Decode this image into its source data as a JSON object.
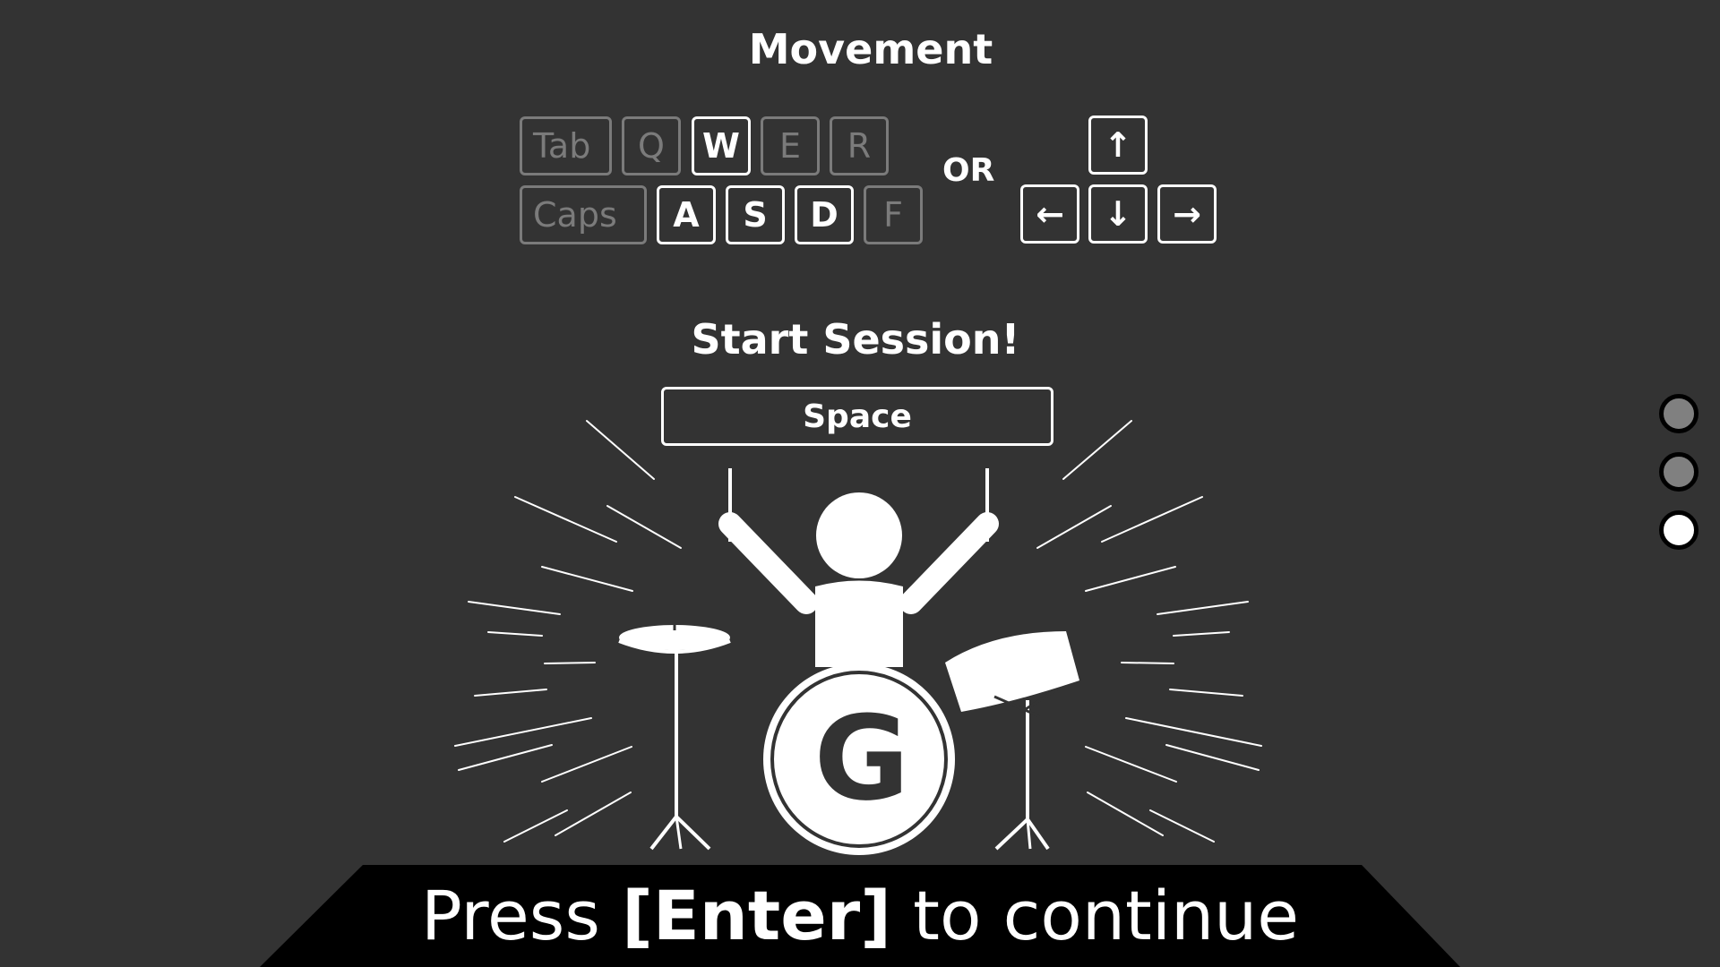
{
  "movement": {
    "title": "Movement",
    "or_label": "OR",
    "keys_row1": [
      "Tab",
      "Q",
      "W",
      "E",
      "R"
    ],
    "keys_row2": [
      "Caps",
      "A",
      "S",
      "D",
      "F"
    ],
    "active_keys": [
      "W",
      "A",
      "S",
      "D"
    ],
    "arrow_keys": {
      "up": "↑",
      "left": "←",
      "down": "↓",
      "right": "→"
    }
  },
  "session": {
    "title": "Start Session!",
    "space_label": "Space"
  },
  "drum_logo_letter": "G",
  "continue": {
    "prefix": "Press ",
    "key": "[Enter]",
    "suffix": " to continue"
  },
  "pagination": {
    "total": 3,
    "active_index": 2
  },
  "colors": {
    "background": "#333333",
    "foreground": "#ffffff",
    "dim_key": "#7b7b7b",
    "banner": "#000000",
    "dot_inactive": "#808080",
    "dot_active": "#ffffff"
  }
}
